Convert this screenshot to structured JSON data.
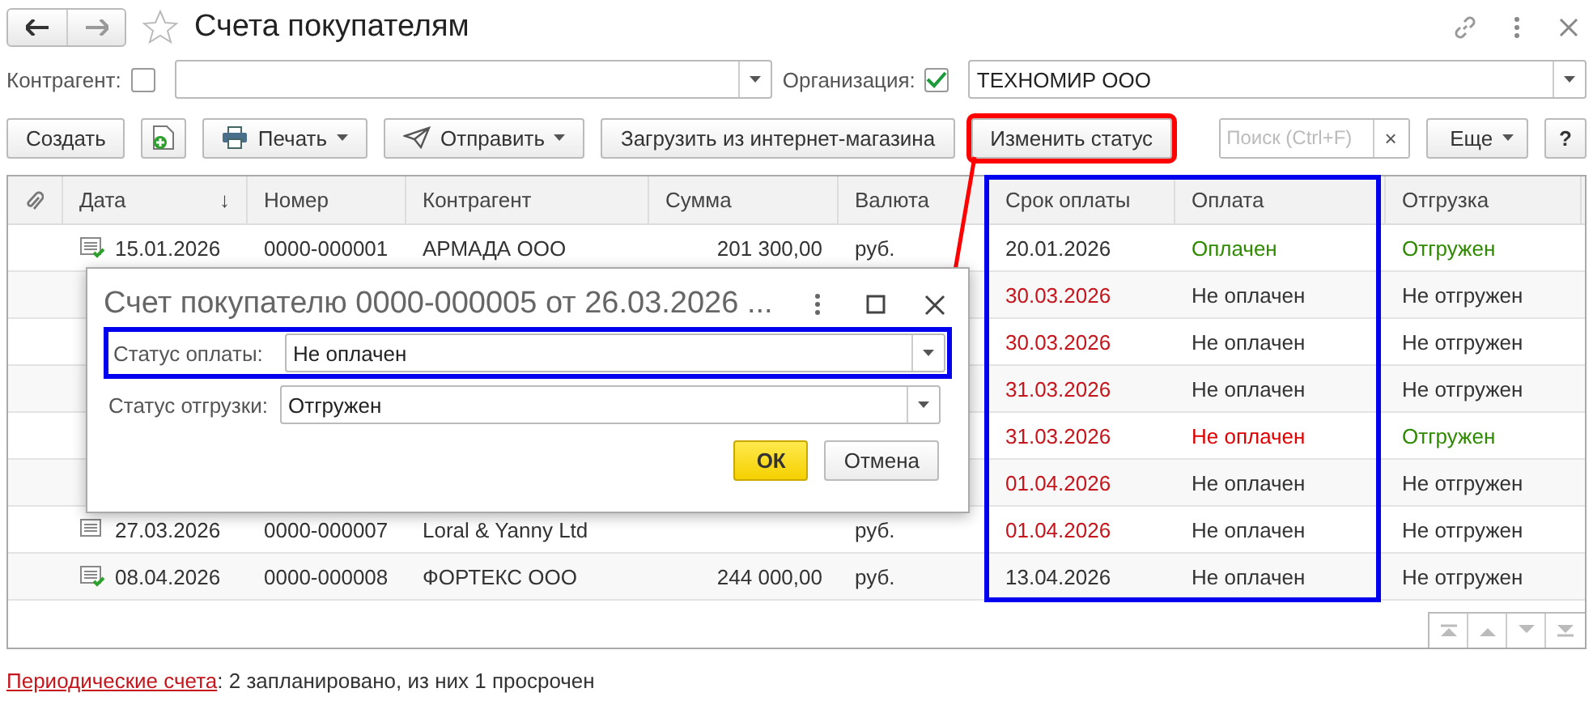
{
  "window": {
    "title": "Счета покупателям"
  },
  "filters": [
    {
      "label": "Контрагент:",
      "checked": false
    },
    {
      "label": "Организация:",
      "checked": true,
      "value": "ТЕХНОМИР ООО"
    }
  ],
  "toolbar": [
    {
      "kind": "button",
      "label": "Создать",
      "highlighted": false
    },
    {
      "kind": "icon",
      "highlighted": false
    },
    {
      "kind": "menu",
      "label": "Печать",
      "highlighted": false
    },
    {
      "kind": "menu",
      "label": "Отправить",
      "highlighted": false
    },
    {
      "kind": "button",
      "label": "Загрузить из интернет-магазина",
      "highlighted": false
    },
    {
      "kind": "button",
      "label": "Изменить статус",
      "highlighted": true
    }
  ],
  "search": {
    "placeholder": "Поиск (Ctrl+F)",
    "clear": "×"
  },
  "more_button": "Еще",
  "help_button": "?",
  "table": {
    "columns": [
      {
        "highlighted": false
      },
      {
        "label": "Дата",
        "highlighted": false,
        "sort": "↓"
      },
      {
        "label": "Номер",
        "highlighted": false
      },
      {
        "label": "Контрагент",
        "highlighted": false
      },
      {
        "label": "Сумма",
        "highlighted": false
      },
      {
        "label": "Валюта",
        "highlighted": false
      },
      {
        "label": "Срок оплаты",
        "highlighted": true
      },
      {
        "label": "Оплата",
        "highlighted": true
      },
      {
        "label": "Отгрузка",
        "highlighted": false
      }
    ],
    "rows": [
      {
        "posted": true,
        "date": "15.01.2026",
        "number": "0000-000001",
        "counterparty": "АРМАДА ООО",
        "sum": "201 300,00",
        "currency": "руб.",
        "due": {
          "text": "20.01.2026",
          "color": "#333333"
        },
        "payment": {
          "text": "Оплачен",
          "color": "#2e8b00"
        },
        "shipment": {
          "text": "Отгружен",
          "color": "#2e8b00"
        }
      },
      {
        "due": {
          "text": "30.03.2026",
          "color": "#c4161c"
        },
        "payment": {
          "text": "Не оплачен",
          "color": "#333333"
        },
        "shipment": {
          "text": "Не отгружен",
          "color": "#333333"
        }
      },
      {
        "due": {
          "text": "30.03.2026",
          "color": "#c4161c"
        },
        "payment": {
          "text": "Не оплачен",
          "color": "#333333"
        },
        "shipment": {
          "text": "Не отгружен",
          "color": "#333333"
        }
      },
      {
        "due": {
          "text": "31.03.2026",
          "color": "#c4161c"
        },
        "payment": {
          "text": "Не оплачен",
          "color": "#333333"
        },
        "shipment": {
          "text": "Не отгружен",
          "color": "#333333"
        }
      },
      {
        "due": {
          "text": "31.03.2026",
          "color": "#c4161c"
        },
        "payment": {
          "text": "Не оплачен",
          "color": "#e00000"
        },
        "shipment": {
          "text": "Отгружен",
          "color": "#2e8b00"
        }
      },
      {
        "due": {
          "text": "01.04.2026",
          "color": "#c4161c"
        },
        "payment": {
          "text": "Не оплачен",
          "color": "#333333"
        },
        "shipment": {
          "text": "Не отгружен",
          "color": "#333333"
        }
      },
      {
        "posted": false,
        "date": "27.03.2026",
        "number": "0000-000007",
        "counterparty": "Loral & Yanny Ltd",
        "sum": "",
        "currency": "руб.",
        "due": {
          "text": "01.04.2026",
          "color": "#c4161c"
        },
        "payment": {
          "text": "Не оплачен",
          "color": "#333333"
        },
        "shipment": {
          "text": "Не отгружен",
          "color": "#333333"
        }
      },
      {
        "posted": true,
        "date": "08.04.2026",
        "number": "0000-000008",
        "counterparty": "ФОРТЕКС ООО",
        "sum": "244 000,00",
        "currency": "руб.",
        "due": {
          "text": "13.04.2026",
          "color": "#333333"
        },
        "payment": {
          "text": "Не оплачен",
          "color": "#333333"
        },
        "shipment": {
          "text": "Не отгружен",
          "color": "#333333"
        }
      }
    ]
  },
  "dialog": {
    "title": "Счет покупателю 0000-000005 от 26.03.2026 ...",
    "fields": [
      {
        "label": "Статус оплаты:",
        "value": "Не оплачен",
        "highlighted": true
      },
      {
        "label": "Статус отгрузки:",
        "value": "Отгружен",
        "highlighted": false
      }
    ],
    "ok": "ОК",
    "cancel": "Отмена"
  },
  "footer": {
    "link": "Периодические счета",
    "text": ": 2 запланировано, из них 1 просрочен"
  }
}
